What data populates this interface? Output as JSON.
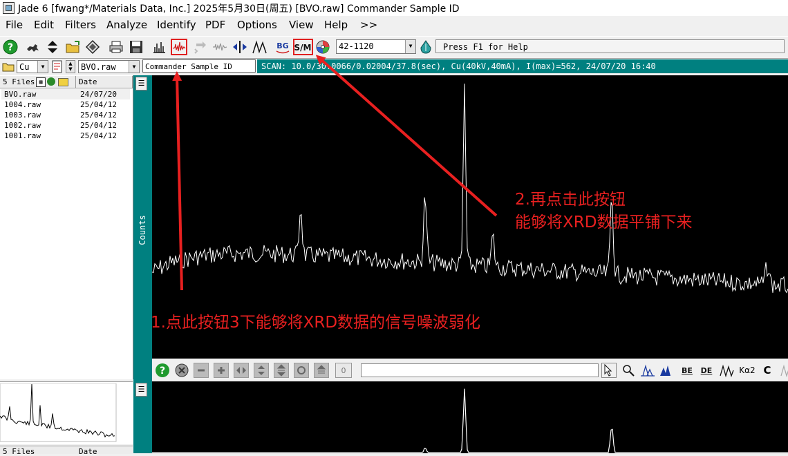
{
  "window": {
    "title": "Jade 6 [fwang*/Materials Data, Inc.] 2025年5月30日(周五) [BVO.raw] Commander Sample ID"
  },
  "menu": [
    "File",
    "Edit",
    "Filters",
    "Analyze",
    "Identify",
    "PDF",
    "Options",
    "View",
    "Help",
    ">>"
  ],
  "toolbar": {
    "icons": [
      "help-icon",
      "dog-icon",
      "up-down-arrows-icon",
      "open-folder-icon",
      "diamond-icon",
      "print-icon",
      "save-icon",
      "bar-pattern-icon",
      "smooth-icon",
      "refresh-icon",
      "noise-icon",
      "center-arrows-icon",
      "peaks-icon",
      "background-icon",
      "strip-kalpha-icon",
      "disc-icon"
    ],
    "bg_label": "BG",
    "sm_label": "S/M",
    "pdf_combo_value": "42-1120",
    "help_text": "Press F1 for Help"
  },
  "second_bar": {
    "element_combo": "Cu",
    "file_combo": "BVO.raw",
    "sample_id": "Commander Sample ID",
    "scan_info": "SCAN: 10.0/30.0066/0.02004/37.8(sec), Cu(40kV,40mA), I(max)=562, 24/07/20 16:40"
  },
  "file_list": {
    "header_files": "5 Files",
    "header_date": "Date",
    "rows": [
      {
        "name": "BVO.raw",
        "date": "24/07/20"
      },
      {
        "name": "1004.raw",
        "date": "25/04/12"
      },
      {
        "name": "1003.raw",
        "date": "25/04/12"
      },
      {
        "name": "1002.raw",
        "date": "25/04/12"
      },
      {
        "name": "1001.raw",
        "date": "25/04/12"
      }
    ],
    "bottom_header_files": "5 Files",
    "bottom_header_date": "Date"
  },
  "plot": {
    "y_axis_label": "Counts"
  },
  "bottom_toolbar": {
    "counter_value": "0",
    "labels": [
      "BE",
      "DE",
      "Kα2",
      "C"
    ]
  },
  "annotations": {
    "step1": "1.点此按钮3下能够将XRD数据的信号噪波弱化",
    "step2_line1": "2.再点击此按钮",
    "step2_line2": "能够将XRD数据平铺下来",
    "color": "#e82020"
  }
}
